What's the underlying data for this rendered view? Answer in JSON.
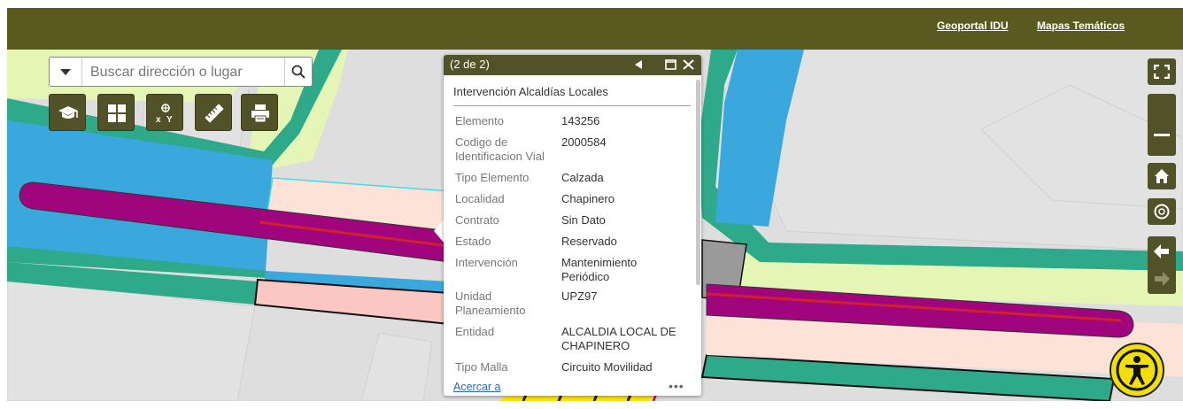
{
  "header": {
    "links": [
      "Geoportal IDU",
      "Mapas Temáticos"
    ]
  },
  "search": {
    "placeholder": "Buscar dirección o lugar"
  },
  "toolbar": {
    "icons": [
      "graduation-cap-icon",
      "basemap-grid-icon",
      "xy-coordinates-icon",
      "measure-ruler-icon",
      "print-icon"
    ]
  },
  "right_controls": {
    "icons": [
      "fullscreen-icon",
      "zoom-out-icon",
      "home-icon",
      "locate-icon",
      "back-arrow-icon",
      "forward-arrow-icon"
    ]
  },
  "popup": {
    "count": "(2 de 2)",
    "title": "Intervención Alcaldías Locales",
    "fields": [
      {
        "label": "Elemento",
        "value": "143256"
      },
      {
        "label": "Codigo de Identificacion Vial",
        "value": "2000584"
      },
      {
        "label": "Tipo Elemento",
        "value": "Calzada"
      },
      {
        "label": "Localidad",
        "value": "Chapinero"
      },
      {
        "label": "Contrato",
        "value": "Sin Dato"
      },
      {
        "label": "Estado",
        "value": "Reservado"
      },
      {
        "label": "Intervención",
        "value": "Mantenimiento Periódico"
      },
      {
        "label": "Unidad Planeamiento",
        "value": "UPZ97"
      },
      {
        "label": "Entidad",
        "value": "ALCALDIA LOCAL DE CHAPINERO"
      },
      {
        "label": "Tipo Malla",
        "value": "Circuito Movilidad"
      }
    ],
    "zoom_link": "Acercar a",
    "more": "•••"
  },
  "colors": {
    "header": "#5a5a20",
    "button": "#525228",
    "sidewalk": "#2eaa8a",
    "road_blue": "#3aa8dc",
    "lane_purple": "#a0057e",
    "red_line": "#d0202a",
    "light_green": "#e4f5b6",
    "pink": "#fde2d8",
    "accessibility": "#f2df0a"
  }
}
